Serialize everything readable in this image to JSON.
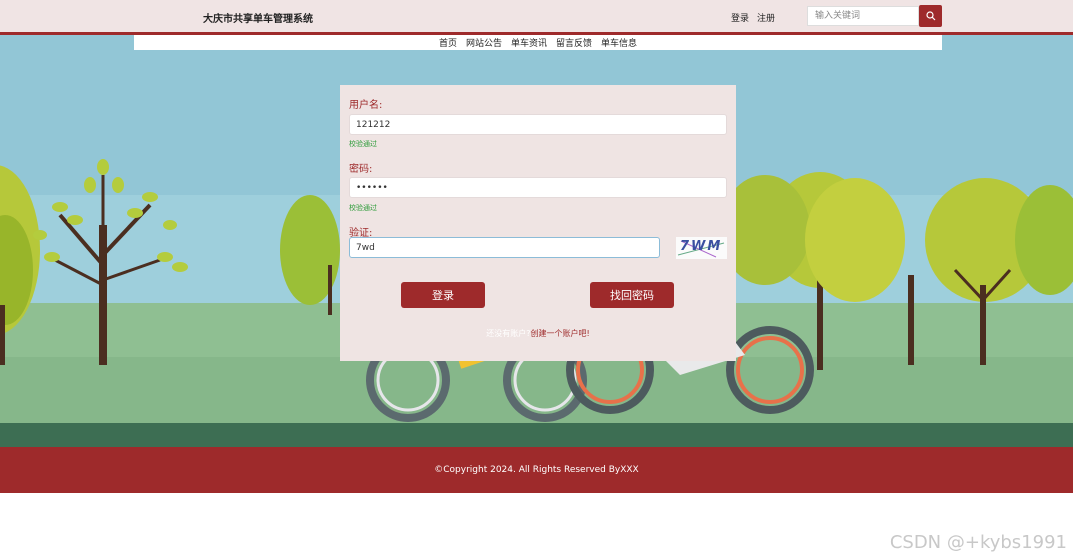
{
  "header": {
    "site_title": "大庆市共享单车管理系统",
    "login_link": "登录",
    "register_link": "注册",
    "search_placeholder": "输入关键词",
    "search_icon": "search-icon"
  },
  "nav": {
    "items": [
      {
        "label": "首页"
      },
      {
        "label": "网站公告"
      },
      {
        "label": "单车资讯"
      },
      {
        "label": "留言反馈"
      },
      {
        "label": "单车信息"
      }
    ]
  },
  "login_form": {
    "username_label": "用户名:",
    "username_value": "121212",
    "username_hint": "校验通过",
    "password_label": "密码:",
    "password_value": "••••••",
    "password_hint": "校验通过",
    "captcha_label": "验证:",
    "captcha_value": "7wd",
    "captcha_text": "7WM",
    "login_button": "登录",
    "recover_button": "找回密码",
    "signup_prompt": "还没有账户?",
    "signup_link": "创建一个账户吧!"
  },
  "footer": {
    "copyright": "©Copyright 2024. All Rights Reserved ByXXX"
  },
  "watermark": "CSDN @+kybs1991",
  "colors": {
    "brand": "#9e2a2b",
    "hint_green": "#2e9c3a",
    "panel_bg": "#efe4e3",
    "topbar_bg": "#f0e4e4"
  }
}
